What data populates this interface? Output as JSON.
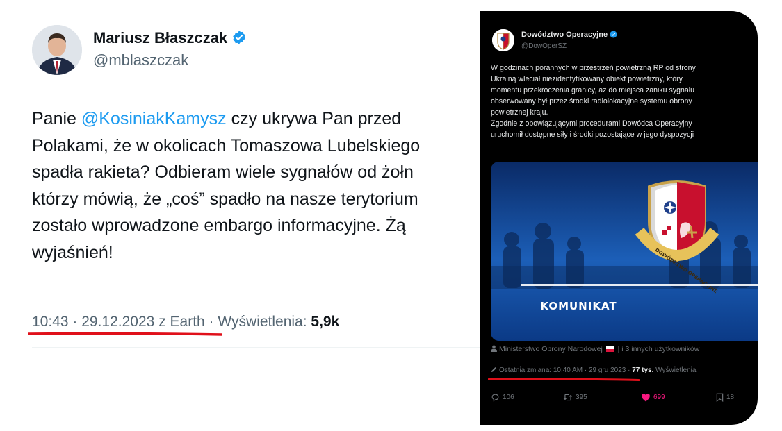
{
  "left_tweet": {
    "author_name": "Mariusz Błaszczak",
    "author_handle": "@mblaszczak",
    "text_lines": [
      [
        "Panie ",
        "@KosiniakKamysz",
        " czy ukrywa Pan przed"
      ],
      "Polakami, że w okolicach Tomaszowa Lubelskiego",
      "spadła rakieta? Odbieram wiele sygnałów od żołn",
      "którzy mówią, że „coś” spadło na nasze terytorium",
      "zostało wprowadzone  embargo informacyjne. Żą",
      "wyjaśnień!"
    ],
    "time": "10:43",
    "date": "29.12.2023",
    "source": "z Earth",
    "views_label": "Wyświetlenia:",
    "views_count": "5,9k",
    "colors": {
      "mention": "#1d9bf0",
      "verified": "#1d9bf0",
      "underline": "#e0101a"
    }
  },
  "embedded_tweet": {
    "author_name": "Dowództwo Operacyjne",
    "author_handle": "@DowOperSZ",
    "text_lines": [
      "W godzinach porannych w przestrzeń powietrzną RP od strony",
      "Ukrainą wleciał niezidentyfikowany obiekt powietrzny, który",
      "momentu przekroczenia granicy, aż do miejsca zaniku sygnału",
      "obserwowany był przez środki radiolokacyjne systemu obrony",
      "powietrznej kraju.",
      "Zgodnie z obowiązującymi procedurami Dowódca Operacyjny",
      "uruchomił dostępne siły i środki pozostające w jego dyspozycji"
    ],
    "media_title": "KOMUNIKAT",
    "emblem_text": "DOWÓDZTWO OPERACYJNE",
    "tagged_user": "Ministerstwo Obrony Narodowej",
    "tagged_others": "i 3 innych użytkowników",
    "edited_label": "Ostatnia zmiana:",
    "edited_time": "10:40 AM · 29 gru 2023",
    "views_count": "77 tys.",
    "views_label": "Wyświetlenia",
    "replies": "106",
    "reposts": "395",
    "likes": "699",
    "bookmarks": "18",
    "colors": {
      "background": "#000000",
      "like": "#f91880",
      "media_bg": "#0c2f6b"
    }
  }
}
